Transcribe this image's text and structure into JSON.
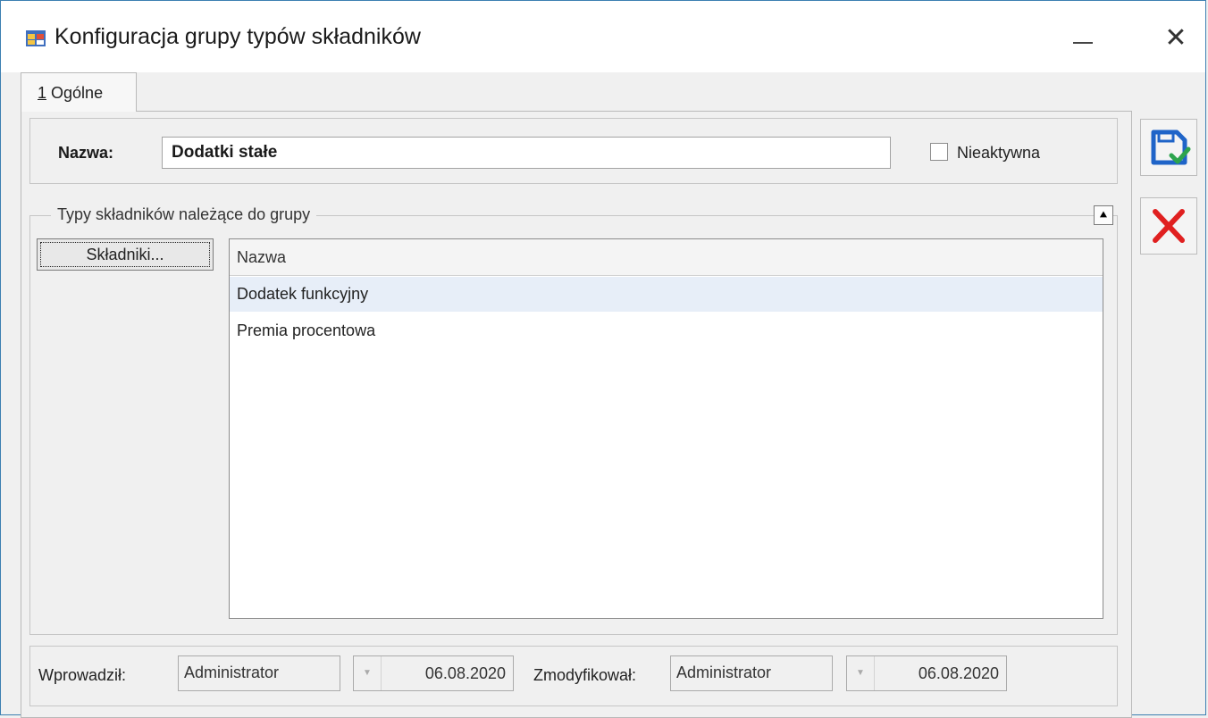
{
  "window": {
    "title": "Konfiguracja grupy typów składników",
    "minimize_glyph": "—",
    "close_glyph": "✕"
  },
  "tabs": [
    {
      "mnemonic": "1",
      "label": "Ogólne",
      "selected": true
    }
  ],
  "form": {
    "name_label": "Nazwa:",
    "name_value": "Dodatki stałe",
    "inactive_label": "Nieaktywna",
    "inactive_checked": false
  },
  "components_group": {
    "legend": "Typy składników należące do grupy",
    "collapse_glyph": "⌃",
    "components_button": "Składniki...",
    "grid": {
      "column": "Nazwa",
      "rows": [
        "Dodatek funkcyjny",
        "Premia procentowa"
      ]
    }
  },
  "footer": {
    "entered_label": "Wprowadził:",
    "entered_user": "Administrator",
    "entered_date": "06.08.2020",
    "modified_label": "Zmodyfikował:",
    "modified_user": "Administrator",
    "modified_date": "06.08.2020"
  },
  "icons": {
    "app": "app-window-icon",
    "save": "save-floppy-check-icon",
    "cancel": "cancel-x-icon",
    "dropdown": "dropdown-arrow-icon"
  },
  "colors": {
    "titlebar": "#ffffff",
    "window_border": "#3c7fb1",
    "selected_row": "#e7eef8",
    "save_blue": "#1f64c8",
    "check_green": "#2da44e",
    "cancel_red": "#e02020"
  }
}
